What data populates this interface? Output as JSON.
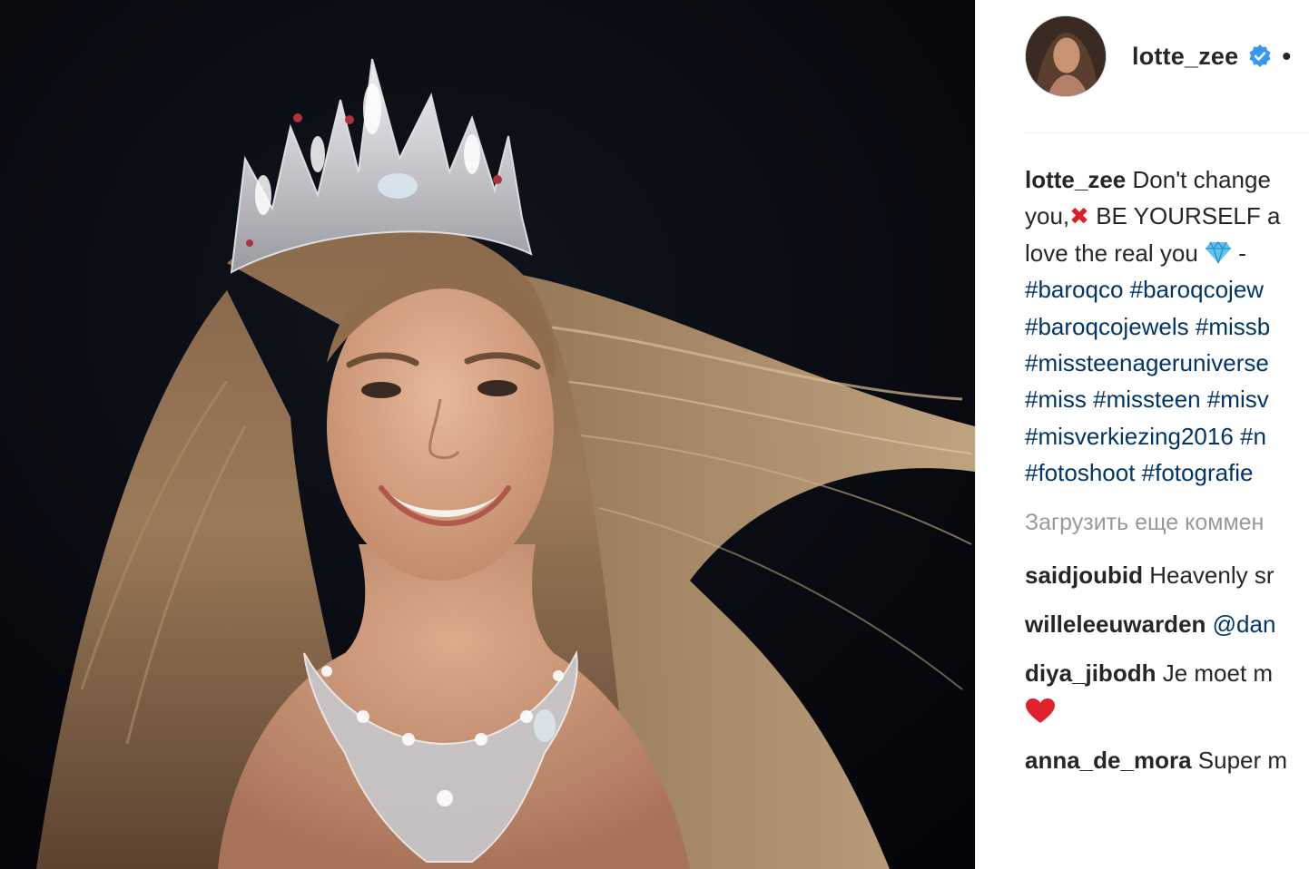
{
  "post": {
    "username": "lotte_zee",
    "header_separator": "•",
    "verified": true,
    "caption_lines": [
      {
        "username": "lotte_zee",
        "text": "Don't change"
      },
      {
        "text_a": "you,",
        "emoji": "cross-mark-emoji",
        "text_b": "BE YOURSELF a"
      },
      {
        "text_a": "love the real you",
        "emoji": "gem-emoji",
        "text_b": "-"
      }
    ],
    "hashtag_lines": [
      "#baroqco #baroqcojew",
      "#baroqcojewels #missb",
      "#missteenageruniverse",
      "#miss #missteen #misv",
      "#misverkiezing2016 #n",
      "#fotoshoot #fotografie"
    ],
    "load_more_label": "Загрузить еще коммен"
  },
  "comments": [
    {
      "username": "saidjoubid",
      "text": "Heavenly sr"
    },
    {
      "username": "willeleeuwarden",
      "mention": "@dan"
    },
    {
      "username": "diya_jibodh",
      "text": "Je moet m",
      "second_line_emoji": "heart-emoji"
    },
    {
      "username": "anna_de_mora",
      "text": "Super m"
    }
  ],
  "icons": {
    "verified": "verified-badge-icon",
    "avatar": "avatar",
    "cross": "cross-mark-emoji",
    "gem": "gem-emoji",
    "heart": "heart-emoji"
  },
  "colors": {
    "hashtag": "#003569",
    "verified": "#3897f0",
    "text": "#262626",
    "muted": "#999999",
    "photo_background": "#06080e",
    "heart": "#e0222f"
  }
}
